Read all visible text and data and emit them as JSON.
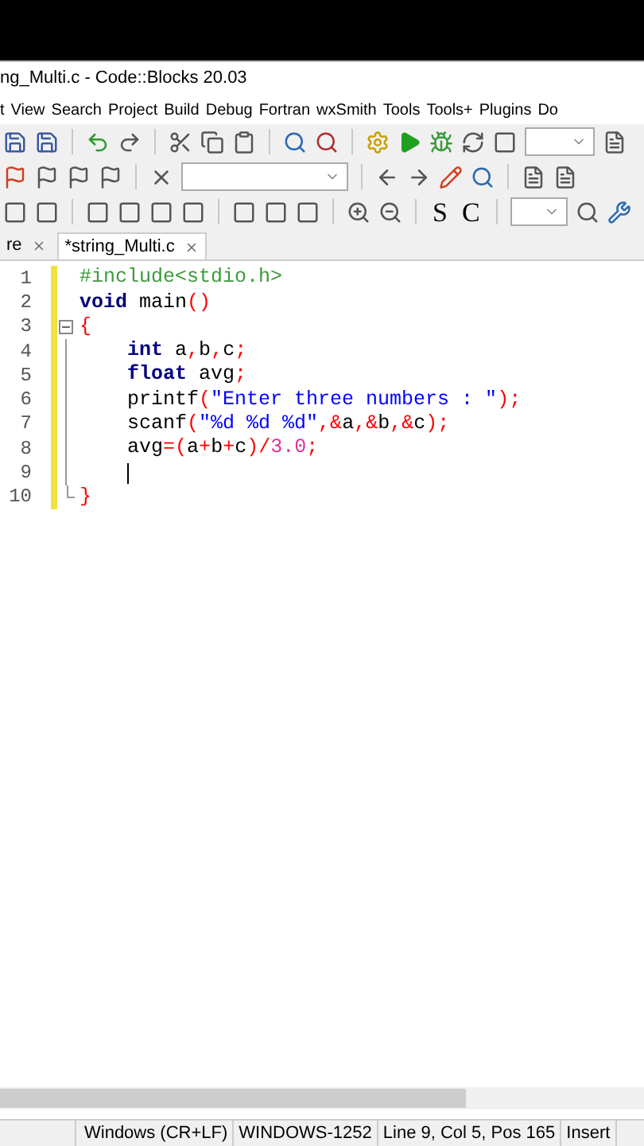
{
  "window": {
    "title": "ng_Multi.c - Code::Blocks 20.03"
  },
  "menu": [
    "t",
    "View",
    "Search",
    "Project",
    "Build",
    "Debug",
    "Fortran",
    "wxSmith",
    "Tools",
    "Tools+",
    "Plugins",
    "Do"
  ],
  "toolbar_letters": [
    "S",
    "C"
  ],
  "tabs": [
    {
      "label": "re",
      "selected": false
    },
    {
      "label": "*string_Multi.c",
      "selected": true
    }
  ],
  "editor": {
    "lines": [
      {
        "number": "1",
        "kind": "plain",
        "tokens": [
          {
            "kind": "pre",
            "text": "#include<stdio.h>"
          }
        ]
      },
      {
        "number": "2",
        "kind": "plain",
        "tokens": [
          {
            "kind": "kw",
            "text": "void"
          },
          {
            "kind": "plain",
            "text": " main"
          },
          {
            "kind": "op",
            "text": "()"
          }
        ]
      },
      {
        "number": "3",
        "kind": "fold-start",
        "tokens": [
          {
            "kind": "op",
            "text": "{"
          }
        ]
      },
      {
        "number": "4",
        "kind": "body",
        "tokens": [
          {
            "kind": "kw",
            "text": "    int"
          },
          {
            "kind": "plain",
            "text": " a"
          },
          {
            "kind": "op",
            "text": ","
          },
          {
            "kind": "plain",
            "text": "b"
          },
          {
            "kind": "op",
            "text": ","
          },
          {
            "kind": "plain",
            "text": "c"
          },
          {
            "kind": "op",
            "text": ";"
          }
        ]
      },
      {
        "number": "5",
        "kind": "body",
        "tokens": [
          {
            "kind": "kw",
            "text": "    float"
          },
          {
            "kind": "plain",
            "text": " avg"
          },
          {
            "kind": "op",
            "text": ";"
          }
        ]
      },
      {
        "number": "6",
        "kind": "body",
        "tokens": [
          {
            "kind": "plain",
            "text": "    printf"
          },
          {
            "kind": "op",
            "text": "("
          },
          {
            "kind": "str",
            "text": "\"Enter three numbers : \""
          },
          {
            "kind": "op",
            "text": ");"
          }
        ]
      },
      {
        "number": "7",
        "kind": "body",
        "tokens": [
          {
            "kind": "plain",
            "text": "    scanf"
          },
          {
            "kind": "op",
            "text": "("
          },
          {
            "kind": "str",
            "text": "\"%d %d %d\""
          },
          {
            "kind": "op",
            "text": ",&"
          },
          {
            "kind": "plain",
            "text": "a"
          },
          {
            "kind": "op",
            "text": ",&"
          },
          {
            "kind": "plain",
            "text": "b"
          },
          {
            "kind": "op",
            "text": ",&"
          },
          {
            "kind": "plain",
            "text": "c"
          },
          {
            "kind": "op",
            "text": ");"
          }
        ]
      },
      {
        "number": "8",
        "kind": "body",
        "tokens": [
          {
            "kind": "plain",
            "text": "    avg"
          },
          {
            "kind": "op",
            "text": "=("
          },
          {
            "kind": "plain",
            "text": "a"
          },
          {
            "kind": "op",
            "text": "+"
          },
          {
            "kind": "plain",
            "text": "b"
          },
          {
            "kind": "op",
            "text": "+"
          },
          {
            "kind": "plain",
            "text": "c"
          },
          {
            "kind": "op",
            "text": ")/"
          },
          {
            "kind": "num",
            "text": "3.0"
          },
          {
            "kind": "op",
            "text": ";"
          }
        ]
      },
      {
        "number": "9",
        "kind": "body",
        "tokens": [
          {
            "kind": "cursor"
          }
        ]
      },
      {
        "number": "10",
        "kind": "fold-end",
        "tokens": [
          {
            "kind": "op",
            "text": "}"
          }
        ]
      }
    ]
  },
  "status_bar": [
    "Windows (CR+LF)",
    "WINDOWS-1252",
    "Line 9, Col 5, Pos 165",
    "Insert"
  ]
}
